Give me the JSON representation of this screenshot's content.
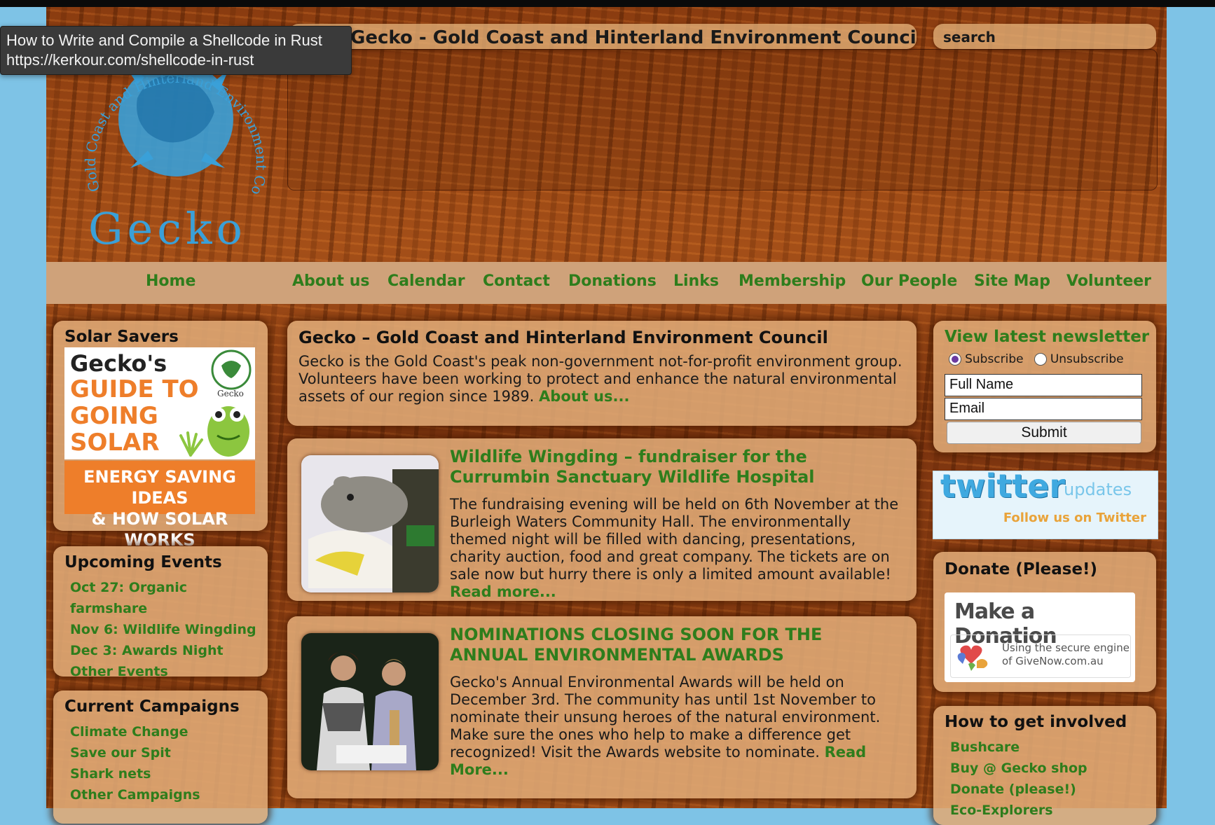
{
  "tooltip": {
    "title": "How to Write and Compile a Shellcode in Rust",
    "url": "https://kerkour.com/shellcode-in-rust"
  },
  "header": {
    "site_title": "Gecko - Gold Coast and Hinterland Environment Council",
    "search_placeholder": "search",
    "logo_word": "Gecko",
    "logo_ring_text": "Gold Coast and Hinterland Environment Council"
  },
  "nav": {
    "items": [
      "Home",
      "About us",
      "Calendar",
      "Contact",
      "Donations",
      "Links",
      "Membership",
      "Our People",
      "Site Map",
      "Volunteer"
    ]
  },
  "left": {
    "solar": {
      "title": "Solar Savers",
      "ad_line1": "Gecko's",
      "ad_line2": "GUIDE TO",
      "ad_line3": "GOING",
      "ad_line4": "SOLAR",
      "ad_badge": "Gecko",
      "ad_bottom1": "ENERGY SAVING IDEAS",
      "ad_bottom2": "& HOW SOLAR WORKS"
    },
    "events": {
      "title": "Upcoming Events",
      "items": [
        "Oct 27: Organic farmshare",
        "Nov 6: Wildlife Wingding",
        "Dec 3: Awards Night",
        "Other Events"
      ]
    },
    "campaigns": {
      "title": "Current Campaigns",
      "items": [
        "Climate Change",
        "Save our Spit",
        "Shark nets",
        "Other Campaigns"
      ]
    }
  },
  "main": {
    "intro": {
      "title": "Gecko – Gold Coast and Hinterland Environment Council",
      "text": "Gecko is the Gold Coast's peak non-government not-for-profit environment group. Volunteers have been working to protect and enhance the natural environmental assets of our region since 1989.",
      "link": "About us..."
    },
    "posts": [
      {
        "title": "Wildlife Wingding – fundraiser for the Currumbin Sanctuary Wildlife Hospital",
        "text": "The fundraising evening will be held on 6th November at the Burleigh Waters Community Hall. The environmentally themed night will be filled with dancing, presentations, charity auction, food and great company. The tickets are on sale now but hurry there is only a limited amount available!",
        "link": "Read more..."
      },
      {
        "title": "NOMINATIONS CLOSING SOON FOR THE ANNUAL ENVIRONMENTAL AWARDS",
        "text": "Gecko's Annual Environmental Awards will be held on December 3rd. The community has until 1st November to nominate their unsung heroes of the natural environment. Make sure the ones who help to make a difference get recognized! Visit the Awards website to nominate.",
        "link": "Read More..."
      }
    ]
  },
  "right": {
    "newsletter": {
      "title": "View latest newsletter",
      "subscribe": "Subscribe",
      "unsubscribe": "Unsubscribe",
      "name_value": "Full Name",
      "email_value": "Email",
      "submit": "Submit"
    },
    "twitter": {
      "logo": "twitter",
      "updates": "updates",
      "follow": "Follow us on Twitter"
    },
    "donate": {
      "title": "Donate (Please!)",
      "badge_title": "Make a Donation",
      "badge_sub1": "Using the secure engine",
      "badge_sub2": "of GiveNow.com.au"
    },
    "involved": {
      "title": "How to get involved",
      "items": [
        "Bushcare",
        "Buy @ Gecko shop",
        "Donate (please!)",
        "Eco-Explorers"
      ]
    }
  },
  "colors": {
    "link_green": "#2e7d1c",
    "panel_tan": "#dfaa76",
    "solar_orange": "#ee7e2a",
    "sky_blue": "#7ec3e6",
    "twitter_blue": "#3fa9e0"
  }
}
